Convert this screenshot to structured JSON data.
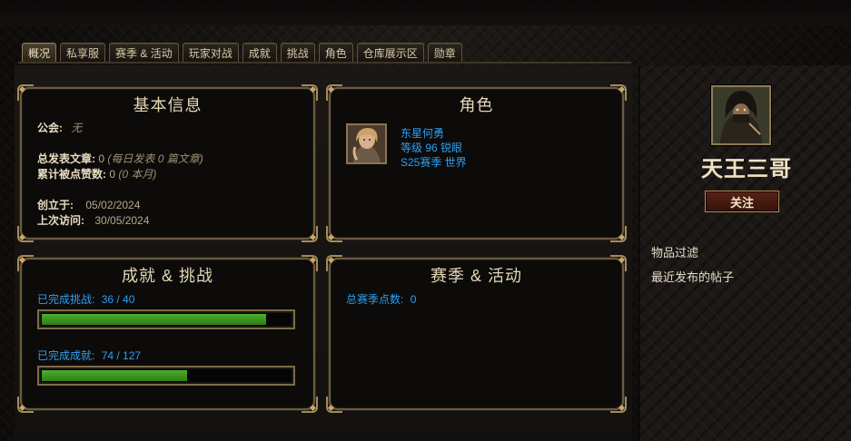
{
  "tabs": [
    "概况",
    "私享服",
    "赛季 & 活动",
    "玩家对战",
    "成就",
    "挑战",
    "角色",
    "仓库展示区",
    "勋章"
  ],
  "active_tab": 0,
  "basic_info": {
    "title": "基本信息",
    "guild_label": "公会:",
    "guild_value": "无",
    "posts_label": "总发表文章:",
    "posts_value": "0",
    "posts_note": "(每日发表 0 篇文章)",
    "likes_label": "累计被点赞数:",
    "likes_value": "0",
    "likes_note": "(0 本月)",
    "created_label": "创立于:",
    "created_value": "05/02/2024",
    "last_visit_label": "上次访问:",
    "last_visit_value": "30/05/2024"
  },
  "character": {
    "title": "角色",
    "name": "东星何勇",
    "level_class": "等级 96 锐眼",
    "season_realm": "S25赛季 世界"
  },
  "achievements": {
    "title": "成就 & 挑战",
    "challenges_label": "已完成挑战:",
    "challenges_text": "36 / 40",
    "challenges_done": 36,
    "challenges_total": 40,
    "achievements_label": "已完成成就:",
    "achievements_text": "74 / 127",
    "achievements_done": 74,
    "achievements_total": 127
  },
  "season": {
    "title": "赛季 & 活动",
    "points_label": "总赛季点数:",
    "points_value": "0"
  },
  "profile": {
    "player_name": "天王三哥",
    "follow_label": "关注",
    "links": [
      "物品过滤",
      "最近发布的帖子"
    ]
  },
  "colors": {
    "accent_blue": "#2f9ff0",
    "bar_green": "#3f9a22",
    "frame_gold": "#a48a5b"
  },
  "icons": [
    "character-portrait-icon",
    "player-avatar-icon"
  ]
}
